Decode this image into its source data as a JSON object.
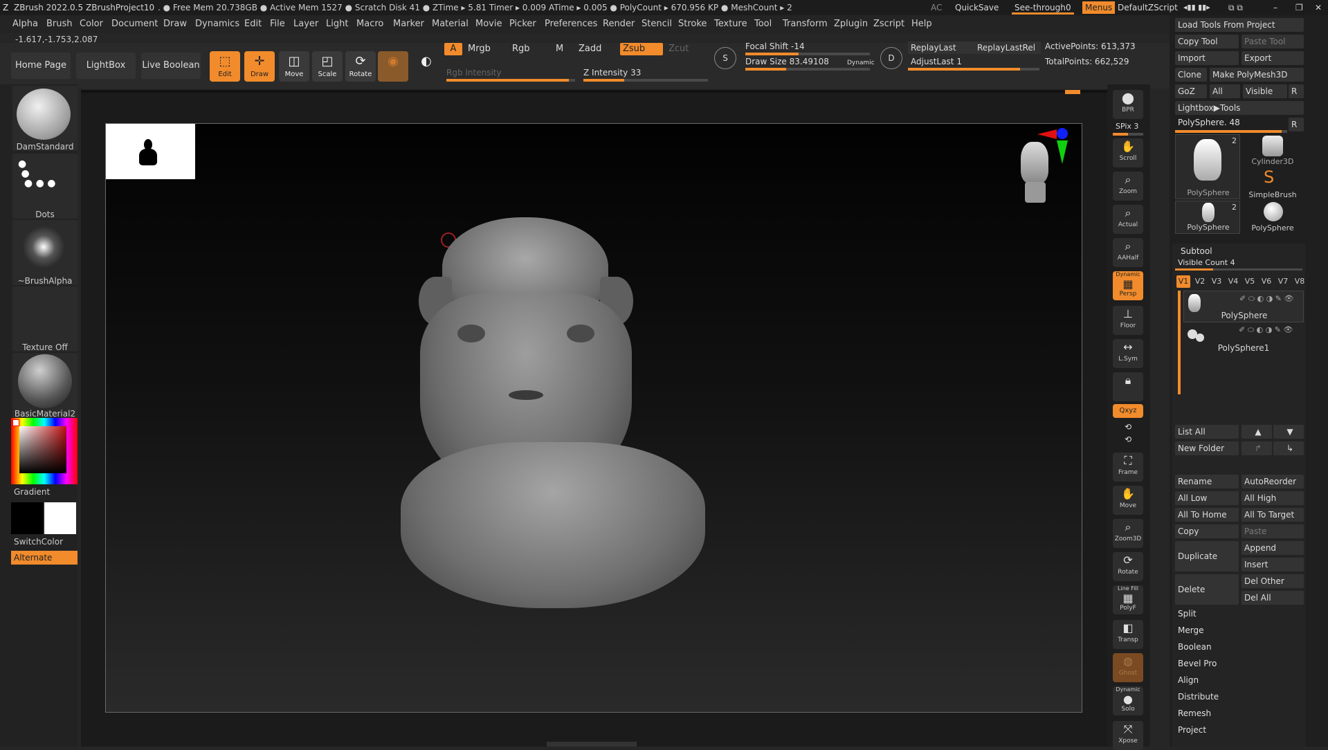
{
  "titlebar": {
    "app": "ZBrush 2022.0.5",
    "project": "ZBrushProject10",
    "stats": ". ● Free Mem 20.738GB ● Active Mem 1527 ● Scratch Disk 41 ● ZTime ▸ 5.81 Timer ▸ 0.009 ATime ▸ 0.005 ● PolyCount ▸ 670.956 KP ● MeshCount ▸ 2",
    "ac": "AC",
    "quicksave": "QuickSave",
    "seethrough_label": "See-through",
    "seethrough_value": "0",
    "menus": "Menus",
    "script": "DefaultZScript"
  },
  "menubar": [
    "Alpha",
    "Brush",
    "Color",
    "Document",
    "Draw",
    "Dynamics",
    "Edit",
    "File",
    "Layer",
    "Light",
    "Macro",
    "Marker",
    "Material",
    "Movie",
    "Picker",
    "Preferences",
    "Render",
    "Stencil",
    "Stroke",
    "Texture",
    "Tool",
    "Transform",
    "Zplugin",
    "Zscript",
    "Help"
  ],
  "coords": "-1.617,-1.753,2.087",
  "nav": {
    "home": "Home Page",
    "lightbox": "LightBox",
    "live_boolean": "Live Boolean"
  },
  "tools": {
    "edit": "Edit",
    "draw": "Draw",
    "move": "Move",
    "scale": "Scale",
    "rotate": "Rotate"
  },
  "modes": {
    "a": "A",
    "mrgb": "Mrgb",
    "rgb": "Rgb",
    "m": "M",
    "zadd": "Zadd",
    "zsub": "Zsub",
    "zcut": "Zcut",
    "rgb_intensity": "Rgb Intensity",
    "z_intensity": "Z Intensity 33"
  },
  "brushparams": {
    "focal_shift": "Focal Shift -14",
    "draw_size": "Draw Size 83.49108",
    "dynamic": "Dynamic",
    "replay_last": "ReplayLast",
    "replay_last_rel": "ReplayLastRel",
    "adjust_last": "AdjustLast 1",
    "active_points": "ActivePoints: 613,373",
    "total_points": "TotalPoints: 662,529",
    "s": "S",
    "d": "D"
  },
  "left": {
    "brush": "DamStandard",
    "stroke": "Dots",
    "alpha": "~BrushAlpha",
    "texture": "Texture Off",
    "material": "BasicMaterial2",
    "gradient": "Gradient",
    "switchcolor": "SwitchColor",
    "alternate": "Alternate"
  },
  "rightstrip": {
    "bpr": "BPR",
    "spix": "SPix 3",
    "scroll": "Scroll",
    "zoom": "Zoom",
    "actual": "Actual",
    "aahalf": "AAHalf",
    "persp_top": "Dynamic",
    "persp": "Persp",
    "floor": "Floor",
    "lsym": "L.Sym",
    "xyz": "Qxyz",
    "frame": "Frame",
    "move": "Move",
    "zoom3d": "Zoom3D",
    "rotate": "Rotate",
    "polyf_top": "Line Fill",
    "polyf": "PolyF",
    "transp": "Transp",
    "ghost": "Ghost",
    "solo_top": "Dynamic",
    "solo": "Solo",
    "xpose": "Xpose"
  },
  "toolpanel": {
    "load_tools": "Load Tools From Project",
    "copy_tool": "Copy Tool",
    "paste_tool": "Paste Tool",
    "import": "Import",
    "export": "Export",
    "clone": "Clone",
    "make_polymesh": "Make PolyMesh3D",
    "goz": "GoZ",
    "all": "All",
    "visible": "Visible",
    "r": "R",
    "lightbox_tools": "Lightbox▶Tools",
    "current_tool": "PolySphere. 48",
    "tools": [
      {
        "name": "PolySphere",
        "count": "2"
      },
      {
        "name": "Cylinder3D"
      },
      {
        "name": "SimpleBrush"
      },
      {
        "name": "PolySphere",
        "count": "2"
      },
      {
        "name": "PolySphere"
      }
    ]
  },
  "subtool": {
    "header": "Subtool",
    "visible_count": "Visible Count 4",
    "tabs": [
      "V1",
      "V2",
      "V3",
      "V4",
      "V5",
      "V6",
      "V7",
      "V8"
    ],
    "items": [
      "PolySphere",
      "PolySphere1"
    ],
    "list_all": "List All",
    "new_folder": "New Folder",
    "rename": "Rename",
    "autoreorder": "AutoReorder",
    "all_low": "All Low",
    "all_high": "All High",
    "all_to_home": "All To Home",
    "all_to_target": "All To Target",
    "copy": "Copy",
    "paste": "Paste",
    "duplicate": "Duplicate",
    "append": "Append",
    "insert": "Insert",
    "delete": "Delete",
    "del_other": "Del Other",
    "del_all": "Del All",
    "sections": [
      "Split",
      "Merge",
      "Boolean",
      "Bevel Pro",
      "Align",
      "Distribute",
      "Remesh",
      "Project"
    ]
  },
  "sliders": {
    "rgb_intensity": 0.95,
    "z_intensity": 0.33,
    "focal_shift": 0.43,
    "draw_size": 0.33,
    "adjust_last": 0.85,
    "spix": 0.5,
    "polysphere": 0.95,
    "visible_count": 0.3
  },
  "colors": {
    "accent": "#f18b2c",
    "primary_color": "#000000",
    "secondary_color": "#ffffff"
  }
}
